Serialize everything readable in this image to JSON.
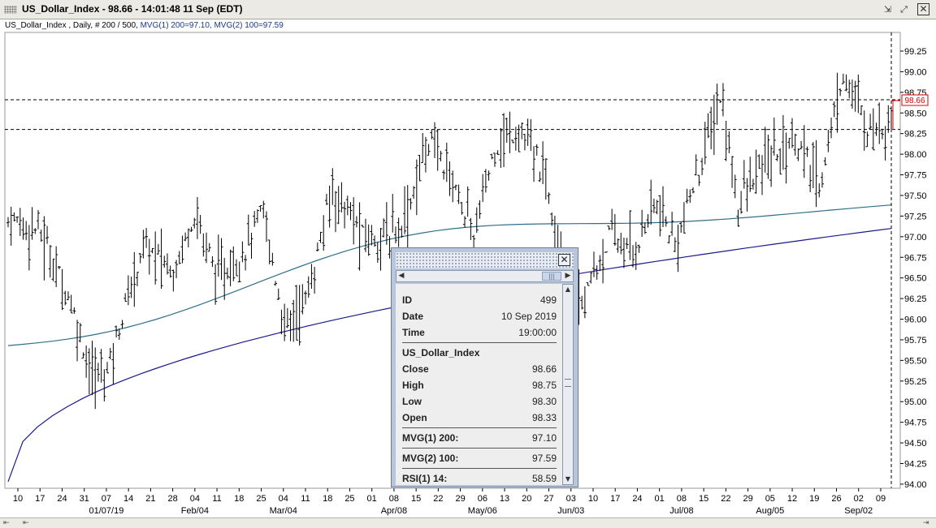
{
  "window": {
    "title": "US_Dollar_Index - 98.66 - 14:01:48  11 Sep (EDT)",
    "icons": [
      "grip-icon",
      "minimize-icon",
      "maximize-icon",
      "close-icon"
    ]
  },
  "subtitle": {
    "main": "US_Dollar_Index , Daily, # 200 / 500,",
    "mvg1": "MVG(1) 200=97.10,",
    "mvg2": "MVG(2) 100=97.59"
  },
  "chart_data": {
    "type": "ohlc",
    "title": "",
    "xlabel": "",
    "ylabel": "",
    "ylim": [
      93.95,
      99.5
    ],
    "y_ticks": [
      "99.25",
      "99.00",
      "98.75",
      "98.50",
      "98.25",
      "98.00",
      "97.75",
      "97.50",
      "97.25",
      "97.00",
      "96.75",
      "96.50",
      "96.25",
      "96.00",
      "95.75",
      "95.50",
      "95.25",
      "95.00",
      "94.75",
      "94.50",
      "94.25",
      "94.00"
    ],
    "x_ticks": [
      "10",
      "17",
      "24",
      "31",
      "07",
      "14",
      "21",
      "28",
      "04",
      "11",
      "18",
      "25",
      "04",
      "11",
      "18",
      "25",
      "01",
      "08",
      "15",
      "22",
      "29",
      "06",
      "13",
      "20",
      "27",
      "03",
      "10",
      "17",
      "24",
      "01",
      "08",
      "15",
      "22",
      "29",
      "05",
      "12",
      "19",
      "26",
      "02",
      "09"
    ],
    "x_month_labels": [
      "01/07/19",
      "Feb/04",
      "Mar/04",
      "Apr/08",
      "May/06",
      "Jun/03",
      "Jul/08",
      "Aug/05",
      "Sep/02"
    ],
    "last_price": "98.66",
    "reference_lines": [
      98.66,
      98.3
    ],
    "series": [
      {
        "name": "MVG(1) 200",
        "color": "#1a1a8c",
        "start": 94.03,
        "end": 97.1
      },
      {
        "name": "MVG(2) 100",
        "color": "#2e6f8a",
        "start": 95.68,
        "end": 97.59
      }
    ]
  },
  "popup": {
    "rows": [
      {
        "key": "ID",
        "value": "499"
      },
      {
        "key": "Date",
        "value": "10 Sep 2019"
      },
      {
        "key": "Time",
        "value": "19:00:00"
      }
    ],
    "instrument": "US_Dollar_Index",
    "prices": [
      {
        "key": "Close",
        "value": "98.66"
      },
      {
        "key": "High",
        "value": "98.75"
      },
      {
        "key": "Low",
        "value": "98.30"
      },
      {
        "key": "Open",
        "value": "98.33"
      }
    ],
    "mvg1": {
      "key": "MVG(1) 200:",
      "value": "97.10"
    },
    "mvg2": {
      "key": "MVG(2) 100:",
      "value": "97.59"
    },
    "rsi": {
      "key": "RSI(1) 14:",
      "value": "58.59"
    }
  }
}
